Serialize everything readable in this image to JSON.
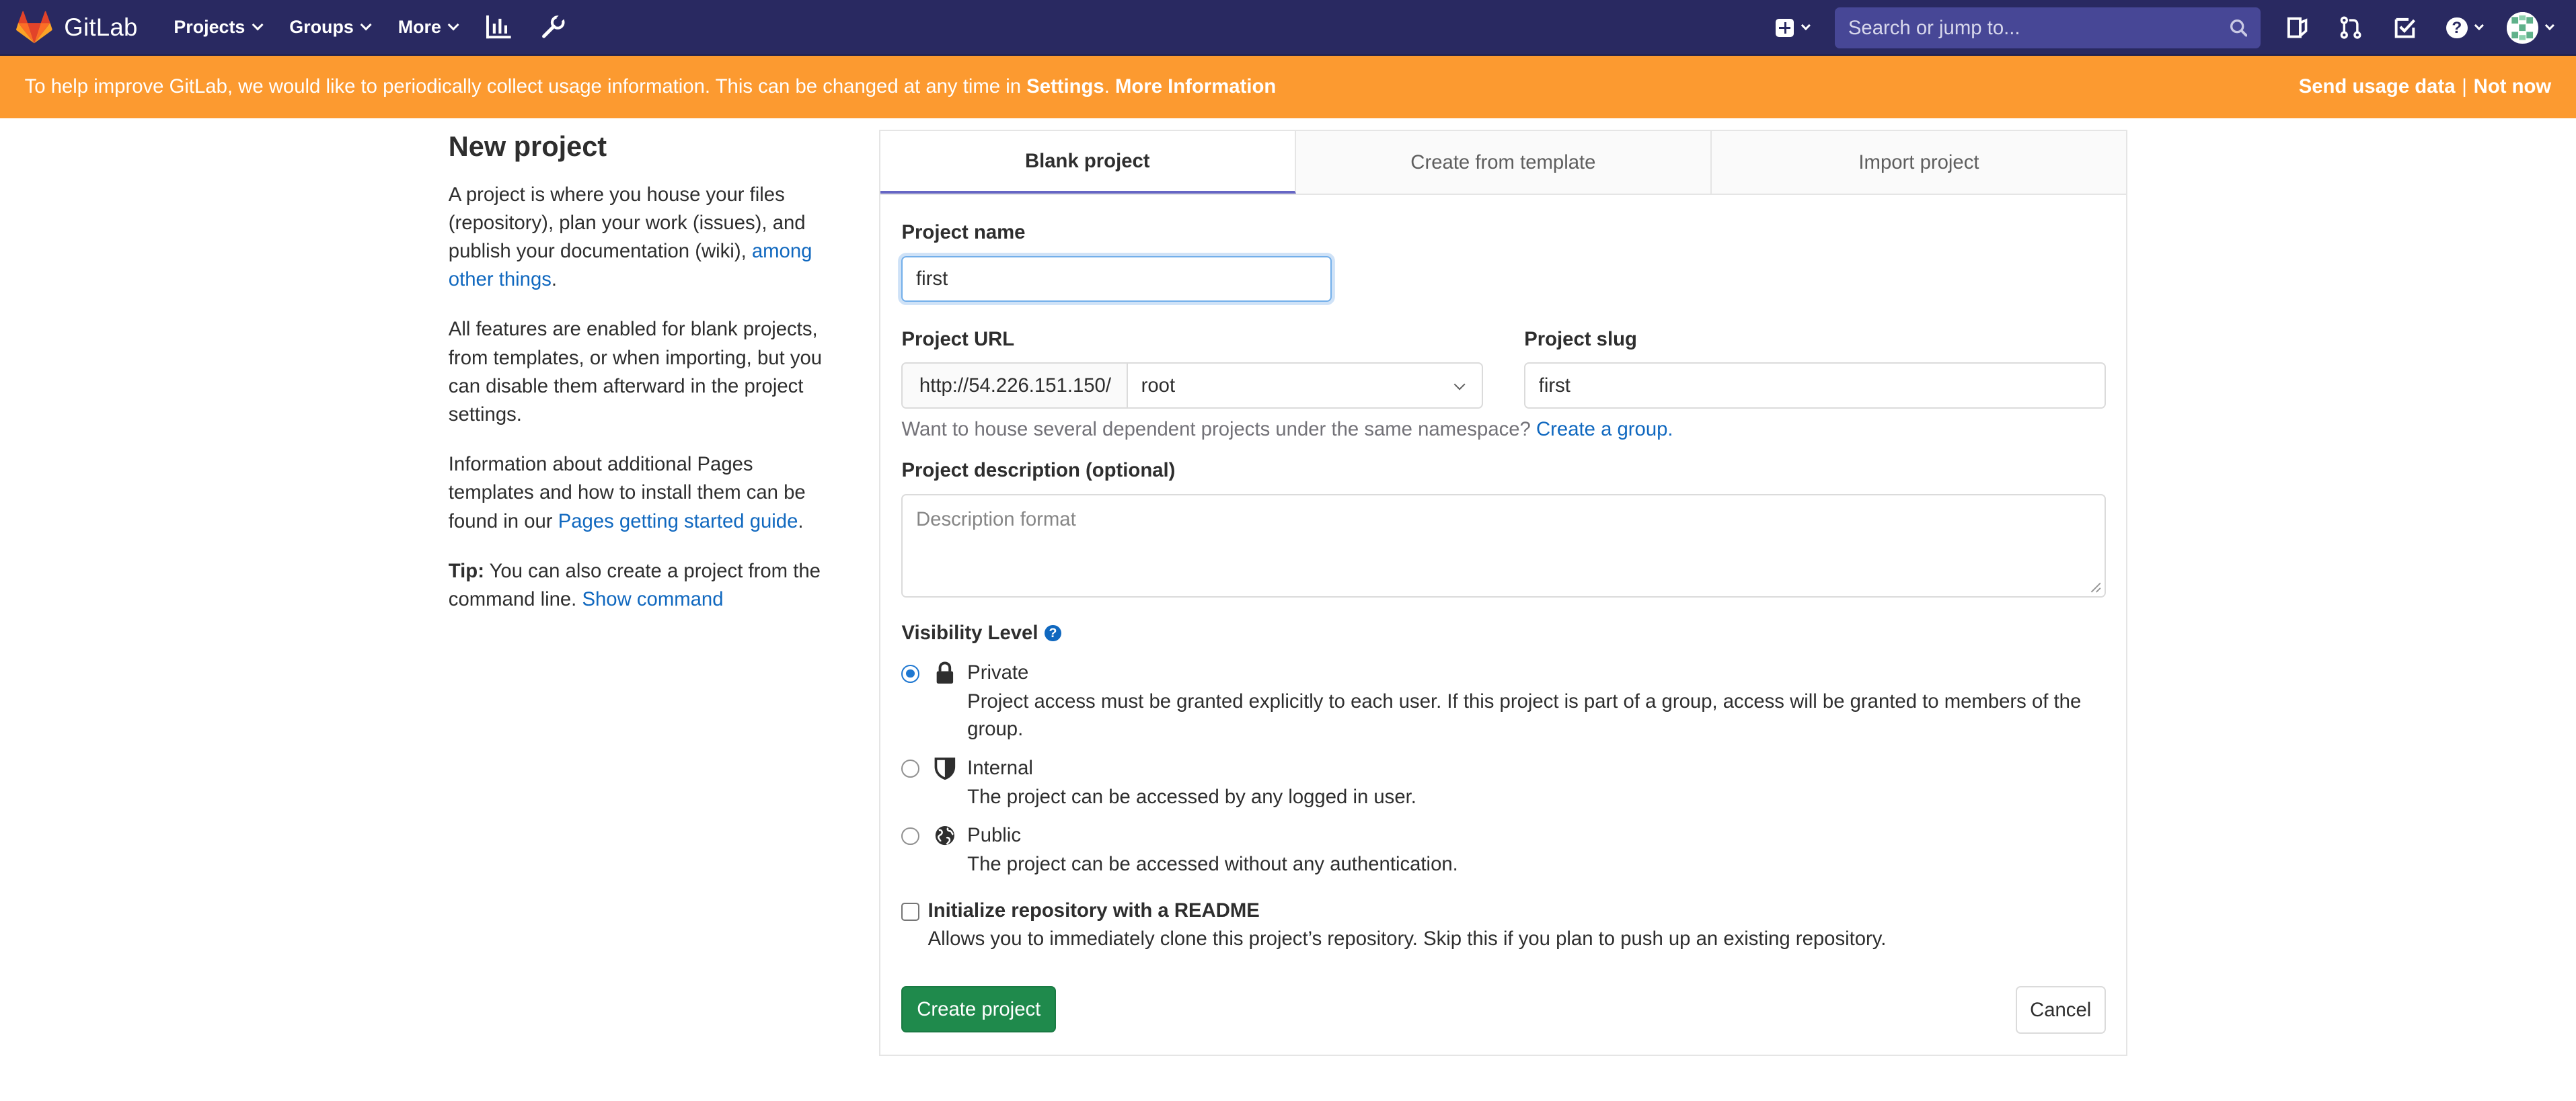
{
  "navbar": {
    "brand": "GitLab",
    "menu": [
      {
        "label": "Projects"
      },
      {
        "label": "Groups"
      },
      {
        "label": "More"
      }
    ],
    "search_placeholder": "Search or jump to...",
    "icons": [
      "activity-chart-icon",
      "wrench-icon",
      "plus-square-icon",
      "search-icon",
      "issues-icon",
      "merge-request-icon",
      "todo-icon",
      "help-icon",
      "user-avatar"
    ],
    "colors": {
      "background": "#292961",
      "accent": "#fc6d26"
    }
  },
  "banner": {
    "text_prefix": "To help improve GitLab, we would like to periodically collect usage information. This can be changed at any time in ",
    "settings_link": "Settings",
    "text_sep": ". ",
    "more_link": "More Information",
    "send_usage": "Send usage data",
    "separator": "|",
    "not_now": "Not now",
    "color": "#fc9a30"
  },
  "sidebar": {
    "title": "New project",
    "p1_text": "A project is where you house your files (repository), plan your work (issues), and publish your documentation (wiki), ",
    "p1_link": "among other things",
    "p1_end": ".",
    "p2_text": "All features are enabled for blank projects, from templates, or when importing, but you can disable them afterward in the project settings.",
    "p3_text": "Information about additional Pages templates and how to install them can be found in our ",
    "p3_link": "Pages getting started guide",
    "p3_end": ".",
    "tip_label": "Tip:",
    "tip_text": " You can also create a project from the command line. ",
    "tip_link": "Show command"
  },
  "tabs": [
    {
      "label": "Blank project",
      "active": true
    },
    {
      "label": "Create from template",
      "active": false
    },
    {
      "label": "Import project",
      "active": false
    }
  ],
  "form": {
    "project_name_label": "Project name",
    "project_name_value": "first",
    "project_url_label": "Project URL",
    "url_prefix": "http://54.226.151.150/",
    "namespace_value": "root",
    "project_slug_label": "Project slug",
    "project_slug_value": "first",
    "namespace_help": "Want to house several dependent projects under the same namespace?",
    "create_group_link": "Create a group.",
    "description_label": "Project description (optional)",
    "description_placeholder": "Description format",
    "visibility_label": "Visibility Level",
    "visibility_help": "?",
    "visibility_options": [
      {
        "title": "Private",
        "description": "Project access must be granted explicitly to each user. If this project is part of a group, access will be granted to members of the group.",
        "checked": true,
        "icon": "lock-icon"
      },
      {
        "title": "Internal",
        "description": "The project can be accessed by any logged in user.",
        "checked": false,
        "icon": "shield-icon"
      },
      {
        "title": "Public",
        "description": "The project can be accessed without any authentication.",
        "checked": false,
        "icon": "globe-icon"
      }
    ],
    "readme_label": "Initialize repository with a README",
    "readme_help": "Allows you to immediately clone this project’s repository. Skip this if you plan to push up an existing repository.",
    "readme_checked": false,
    "create_button": "Create project",
    "cancel_button": "Cancel",
    "create_button_color": "#1f8a4c"
  }
}
